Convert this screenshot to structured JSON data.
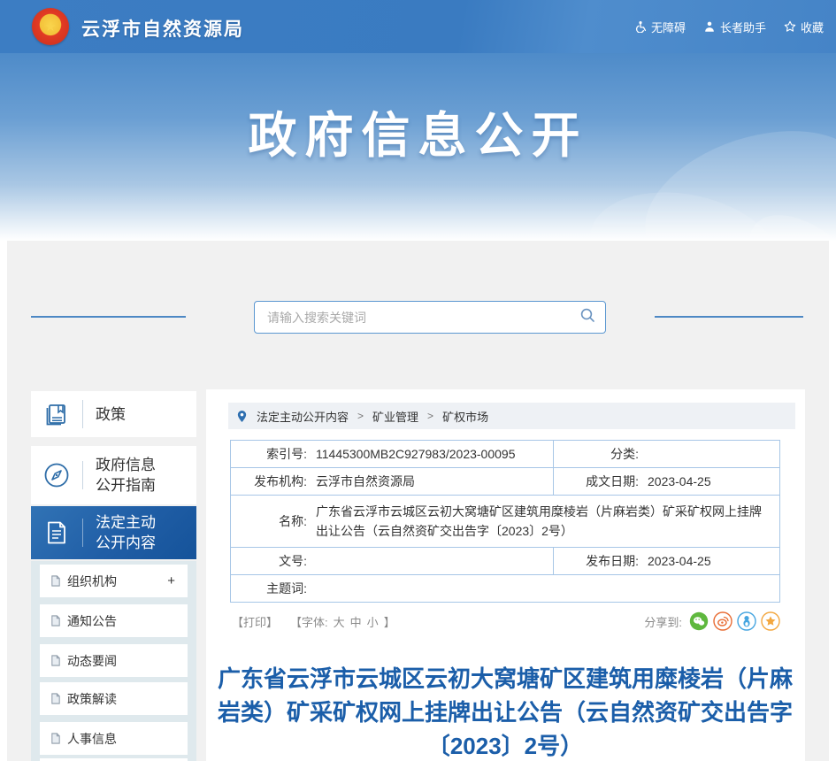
{
  "header": {
    "site_title": "云浮市自然资源局",
    "links": [
      {
        "label": "无障碍",
        "icon": "accessibility-icon"
      },
      {
        "label": "长者助手",
        "icon": "elder-assistant-icon"
      },
      {
        "label": "收藏",
        "icon": "star-icon"
      }
    ]
  },
  "banner": {
    "title": "政府信息公开"
  },
  "search": {
    "placeholder": "请输入搜索关键词",
    "icon": "search-icon"
  },
  "sidebar": {
    "main_items": [
      {
        "label": "政策",
        "icon": "book-icon",
        "active": false
      },
      {
        "label": "政府信息公开指南",
        "icon": "compass-icon",
        "active": false
      },
      {
        "label": "法定主动公开内容",
        "icon": "document-icon",
        "active": true
      }
    ],
    "sub_items": [
      {
        "label": "组织机构",
        "icon": "page-icon",
        "expander": "+"
      },
      {
        "label": "通知公告",
        "icon": "page-icon"
      },
      {
        "label": "动态要闻",
        "icon": "page-icon"
      },
      {
        "label": "政策解读",
        "icon": "page-icon"
      },
      {
        "label": "人事信息",
        "icon": "page-icon"
      }
    ]
  },
  "breadcrumb": {
    "icon": "location-pin-icon",
    "items": [
      "法定主动公开内容",
      "矿业管理",
      "矿权市场"
    ],
    "separator": ">"
  },
  "meta_table": {
    "index_label": "索引号:",
    "index_value": "11445300MB2C927983/2023-00095",
    "category_label": "分类:",
    "category_value": "",
    "agency_label": "发布机构:",
    "agency_value": "云浮市自然资源局",
    "written_date_label": "成文日期:",
    "written_date_value": "2023-04-25",
    "name_label": "名称:",
    "name_value": "广东省云浮市云城区云初大窝塘矿区建筑用糜棱岩（片麻岩类）矿采矿权网上挂牌出让公告（云自然资矿交出告字〔2023〕2号）",
    "doc_number_label": "文号:",
    "doc_number_value": "",
    "publish_date_label": "发布日期:",
    "publish_date_value": "2023-04-25",
    "keywords_label": "主题词:",
    "keywords_value": ""
  },
  "toolbar": {
    "print_label": "【打印】",
    "font_prefix": "【字体:",
    "font_sizes": [
      "大",
      "中",
      "小"
    ],
    "font_suffix": "】",
    "share_label": "分享到:",
    "share_icons": [
      "wechat-share-icon",
      "weibo-share-icon",
      "qq-share-icon",
      "qzone-share-icon"
    ]
  },
  "article": {
    "title": "广东省云浮市云城区云初大窝塘矿区建筑用糜棱岩（片麻岩类）矿采矿权网上挂牌出让公告（云自然资矿交出告字〔2023〕2号）"
  },
  "colors": {
    "header_blue": "#3c7dc3",
    "active_item_blue": "#205ea6",
    "article_title_blue": "#1b5ea9",
    "table_border_blue": "#a7c6e6",
    "deco_line_blue": "#4d88c4",
    "panel_gray": "#f1f1f1",
    "submenu_gray": "#dfe9ed",
    "wechat_green": "#5fb83e",
    "weibo_orange": "#e86c34",
    "qq_blue": "#45a5e0",
    "qzone_orange": "#f3a73f"
  }
}
